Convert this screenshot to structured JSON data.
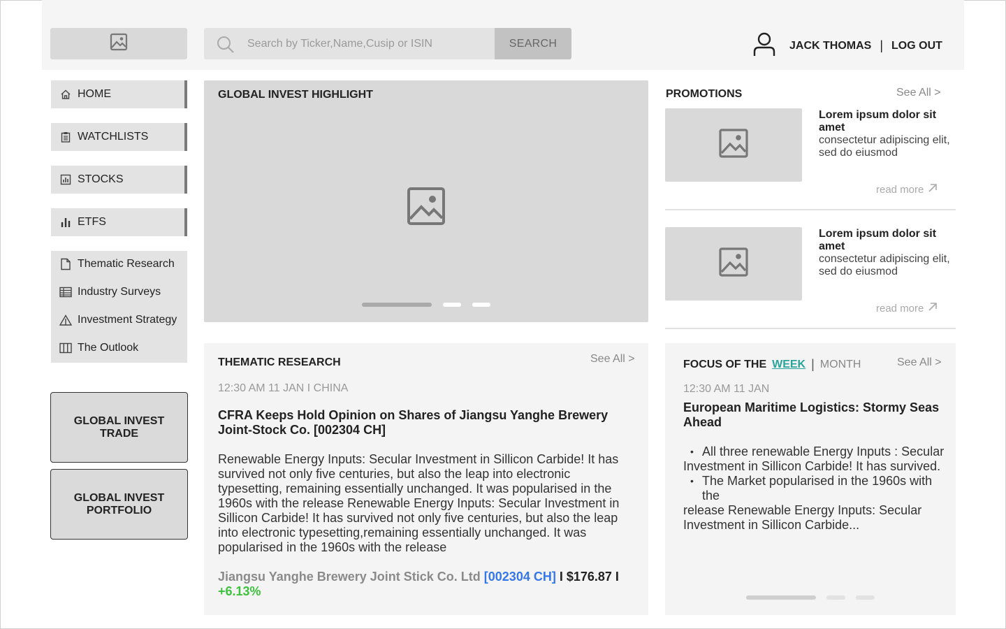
{
  "header": {
    "search_placeholder": "Search by Ticker,Name,Cusip or ISIN",
    "search_button": "SEARCH",
    "user_name": "JACK THOMAS",
    "separator": "|",
    "logout": "LOG OUT"
  },
  "sidebar": {
    "nav": [
      {
        "label": "HOME",
        "icon": "home-icon"
      },
      {
        "label": "WATCHLISTS",
        "icon": "clipboard-icon"
      },
      {
        "label": "STOCKS",
        "icon": "bar-chart-icon"
      },
      {
        "label": "ETFS",
        "icon": "bars-icon"
      }
    ],
    "sub": [
      {
        "label": "Thematic Research",
        "icon": "document-icon"
      },
      {
        "label": "Industry Surveys",
        "icon": "table-icon"
      },
      {
        "label": "Investment Strategy",
        "icon": "warning-triangle-icon"
      },
      {
        "label": "The Outlook",
        "icon": "columns-icon"
      }
    ],
    "trade_button": "GLOBAL INVEST TRADE",
    "portfolio_button": "GLOBAL INVEST PORTFOLIO"
  },
  "highlight": {
    "title": "GLOBAL INVEST HIGHLIGHT"
  },
  "promotions": {
    "title": "PROMOTIONS",
    "see_all": "See All >",
    "items": [
      {
        "title": "Lorem ipsum dolor sit amet",
        "text": "consectetur adipiscing elit, sed do eiusmod",
        "read_more": "read more"
      },
      {
        "title": "Lorem ipsum dolor sit amet",
        "text": "consectetur adipiscing elit, sed do eiusmod",
        "read_more": "read more"
      }
    ]
  },
  "thematic": {
    "title": "THEMATIC RESEARCH",
    "see_all": "See All >",
    "meta": "12:30 AM 11 JAN I CHINA",
    "headline": "CFRA Keeps Hold Opinion on Shares of Jiangsu Yanghe Brewery Joint-Stock Co. [002304 CH]",
    "body": "Renewable Energy Inputs: Secular Investment in Sillicon Carbide! It has survived not only five centuries, but also the leap into electronic typesetting, remaining essentially unchanged. It was popularised in the 1960s with the release Renewable Energy Inputs: Secular Investment in Sillicon Carbide! It has survived not only five centuries, but also the leap into electronic typesetting,remaining essentially unchanged. It was popularised in the 1960s with the release",
    "company": "Jiangsu Yanghe Brewery Joint Stick Co. Ltd",
    "ticker": "[002304 CH]",
    "price": "I $176.87 I",
    "change": "+6.13%",
    "colors": {
      "company": "#8a8a8a",
      "ticker": "#3577e8",
      "change": "#3ec23e"
    }
  },
  "focus": {
    "title": "FOCUS OF THE",
    "week": "WEEK",
    "separator": "|",
    "month": "MONTH",
    "see_all": "See All >",
    "meta": "12:30 AM 11 JAN",
    "headline": "European Maritime Logistics: Stormy Seas Ahead",
    "bullet1": "All three renewable Energy Inputs : Secular",
    "line1": "Investment in Sillicon Carbide! It has survived.",
    "bullet2": "The Market popularised in the 1960s with the",
    "line2": "release Renewable Energy Inputs: Secular Investment in Sillicon Carbide...",
    "accent": "#2aa39a"
  }
}
